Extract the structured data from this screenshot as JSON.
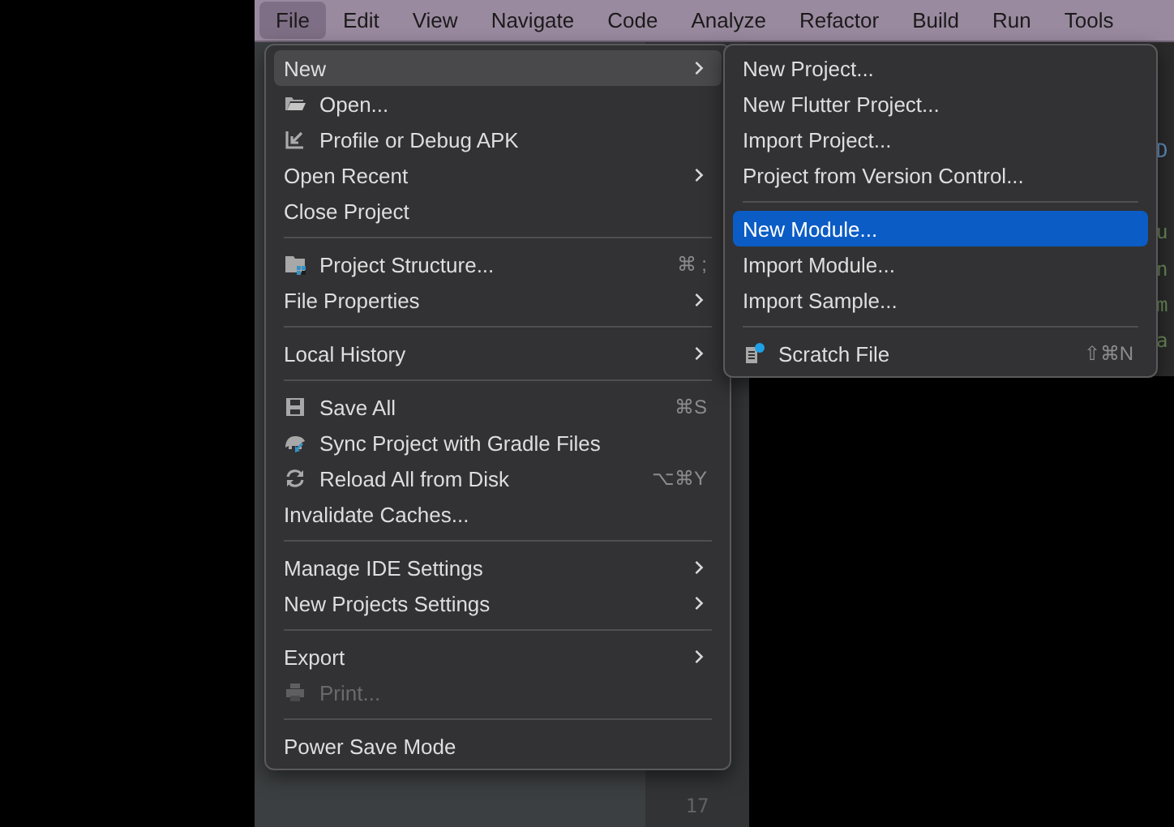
{
  "menu_bar": [
    {
      "label": "File",
      "selected": true
    },
    {
      "label": "Edit",
      "selected": false
    },
    {
      "label": "View",
      "selected": false
    },
    {
      "label": "Navigate",
      "selected": false
    },
    {
      "label": "Code",
      "selected": false
    },
    {
      "label": "Analyze",
      "selected": false
    },
    {
      "label": "Refactor",
      "selected": false
    },
    {
      "label": "Build",
      "selected": false
    },
    {
      "label": "Run",
      "selected": false
    },
    {
      "label": "Tools",
      "selected": false
    }
  ],
  "file_menu": [
    {
      "kind": "item",
      "label": "New",
      "submenu": true,
      "selected": true,
      "disabled": false
    },
    {
      "kind": "item",
      "label": "Open...",
      "submenu": false,
      "selected": false,
      "disabled": false
    },
    {
      "kind": "item",
      "label": "Profile or Debug APK",
      "submenu": false,
      "selected": false,
      "disabled": false
    },
    {
      "kind": "item",
      "label": "Open Recent",
      "submenu": true,
      "selected": false,
      "disabled": false
    },
    {
      "kind": "item",
      "label": "Close Project",
      "submenu": false,
      "selected": false,
      "disabled": false
    },
    {
      "kind": "separator"
    },
    {
      "kind": "item",
      "label": "Project Structure...",
      "shortcut": "⌘ ;",
      "submenu": false,
      "selected": false,
      "disabled": false
    },
    {
      "kind": "item",
      "label": "File Properties",
      "submenu": true,
      "selected": false,
      "disabled": false
    },
    {
      "kind": "separator"
    },
    {
      "kind": "item",
      "label": "Local History",
      "submenu": true,
      "selected": false,
      "disabled": false
    },
    {
      "kind": "separator"
    },
    {
      "kind": "item",
      "label": "Save All",
      "shortcut": "⌘S",
      "submenu": false,
      "selected": false,
      "disabled": false
    },
    {
      "kind": "item",
      "label": "Sync Project with Gradle Files",
      "submenu": false,
      "selected": false,
      "disabled": false
    },
    {
      "kind": "item",
      "label": "Reload All from Disk",
      "shortcut": "⌥⌘Y",
      "submenu": false,
      "selected": false,
      "disabled": false
    },
    {
      "kind": "item",
      "label": "Invalidate Caches...",
      "submenu": false,
      "selected": false,
      "disabled": false
    },
    {
      "kind": "separator"
    },
    {
      "kind": "item",
      "label": "Manage IDE Settings",
      "submenu": true,
      "selected": false,
      "disabled": false
    },
    {
      "kind": "item",
      "label": "New Projects Settings",
      "submenu": true,
      "selected": false,
      "disabled": false
    },
    {
      "kind": "separator"
    },
    {
      "kind": "item",
      "label": "Export",
      "submenu": true,
      "selected": false,
      "disabled": false
    },
    {
      "kind": "item",
      "label": "Print...",
      "submenu": false,
      "selected": false,
      "disabled": true
    },
    {
      "kind": "separator"
    },
    {
      "kind": "item",
      "label": "Power Save Mode",
      "submenu": false,
      "selected": false,
      "disabled": false
    }
  ],
  "new_submenu": [
    {
      "kind": "item",
      "label": "New Project...",
      "selected": false
    },
    {
      "kind": "item",
      "label": "New Flutter Project...",
      "selected": false
    },
    {
      "kind": "item",
      "label": "Import Project...",
      "selected": false
    },
    {
      "kind": "item",
      "label": "Project from Version Control...",
      "selected": false
    },
    {
      "kind": "separator"
    },
    {
      "kind": "item",
      "label": "New Module...",
      "selected": true
    },
    {
      "kind": "item",
      "label": "Import Module...",
      "selected": false
    },
    {
      "kind": "item",
      "label": "Import Sample...",
      "selected": false
    },
    {
      "kind": "separator"
    },
    {
      "kind": "item",
      "label": "Scratch File",
      "shortcut": "⇧⌘N",
      "selected": false
    }
  ],
  "editor": {
    "line_numbers": [
      "17"
    ],
    "code_fragments": [
      {
        "text": "D",
        "kind": "link"
      },
      {
        "text": "u",
        "kind": "string"
      },
      {
        "text": "n",
        "kind": "string"
      },
      {
        "text": "m",
        "kind": "string"
      },
      {
        "text": "a",
        "kind": "string"
      }
    ]
  }
}
